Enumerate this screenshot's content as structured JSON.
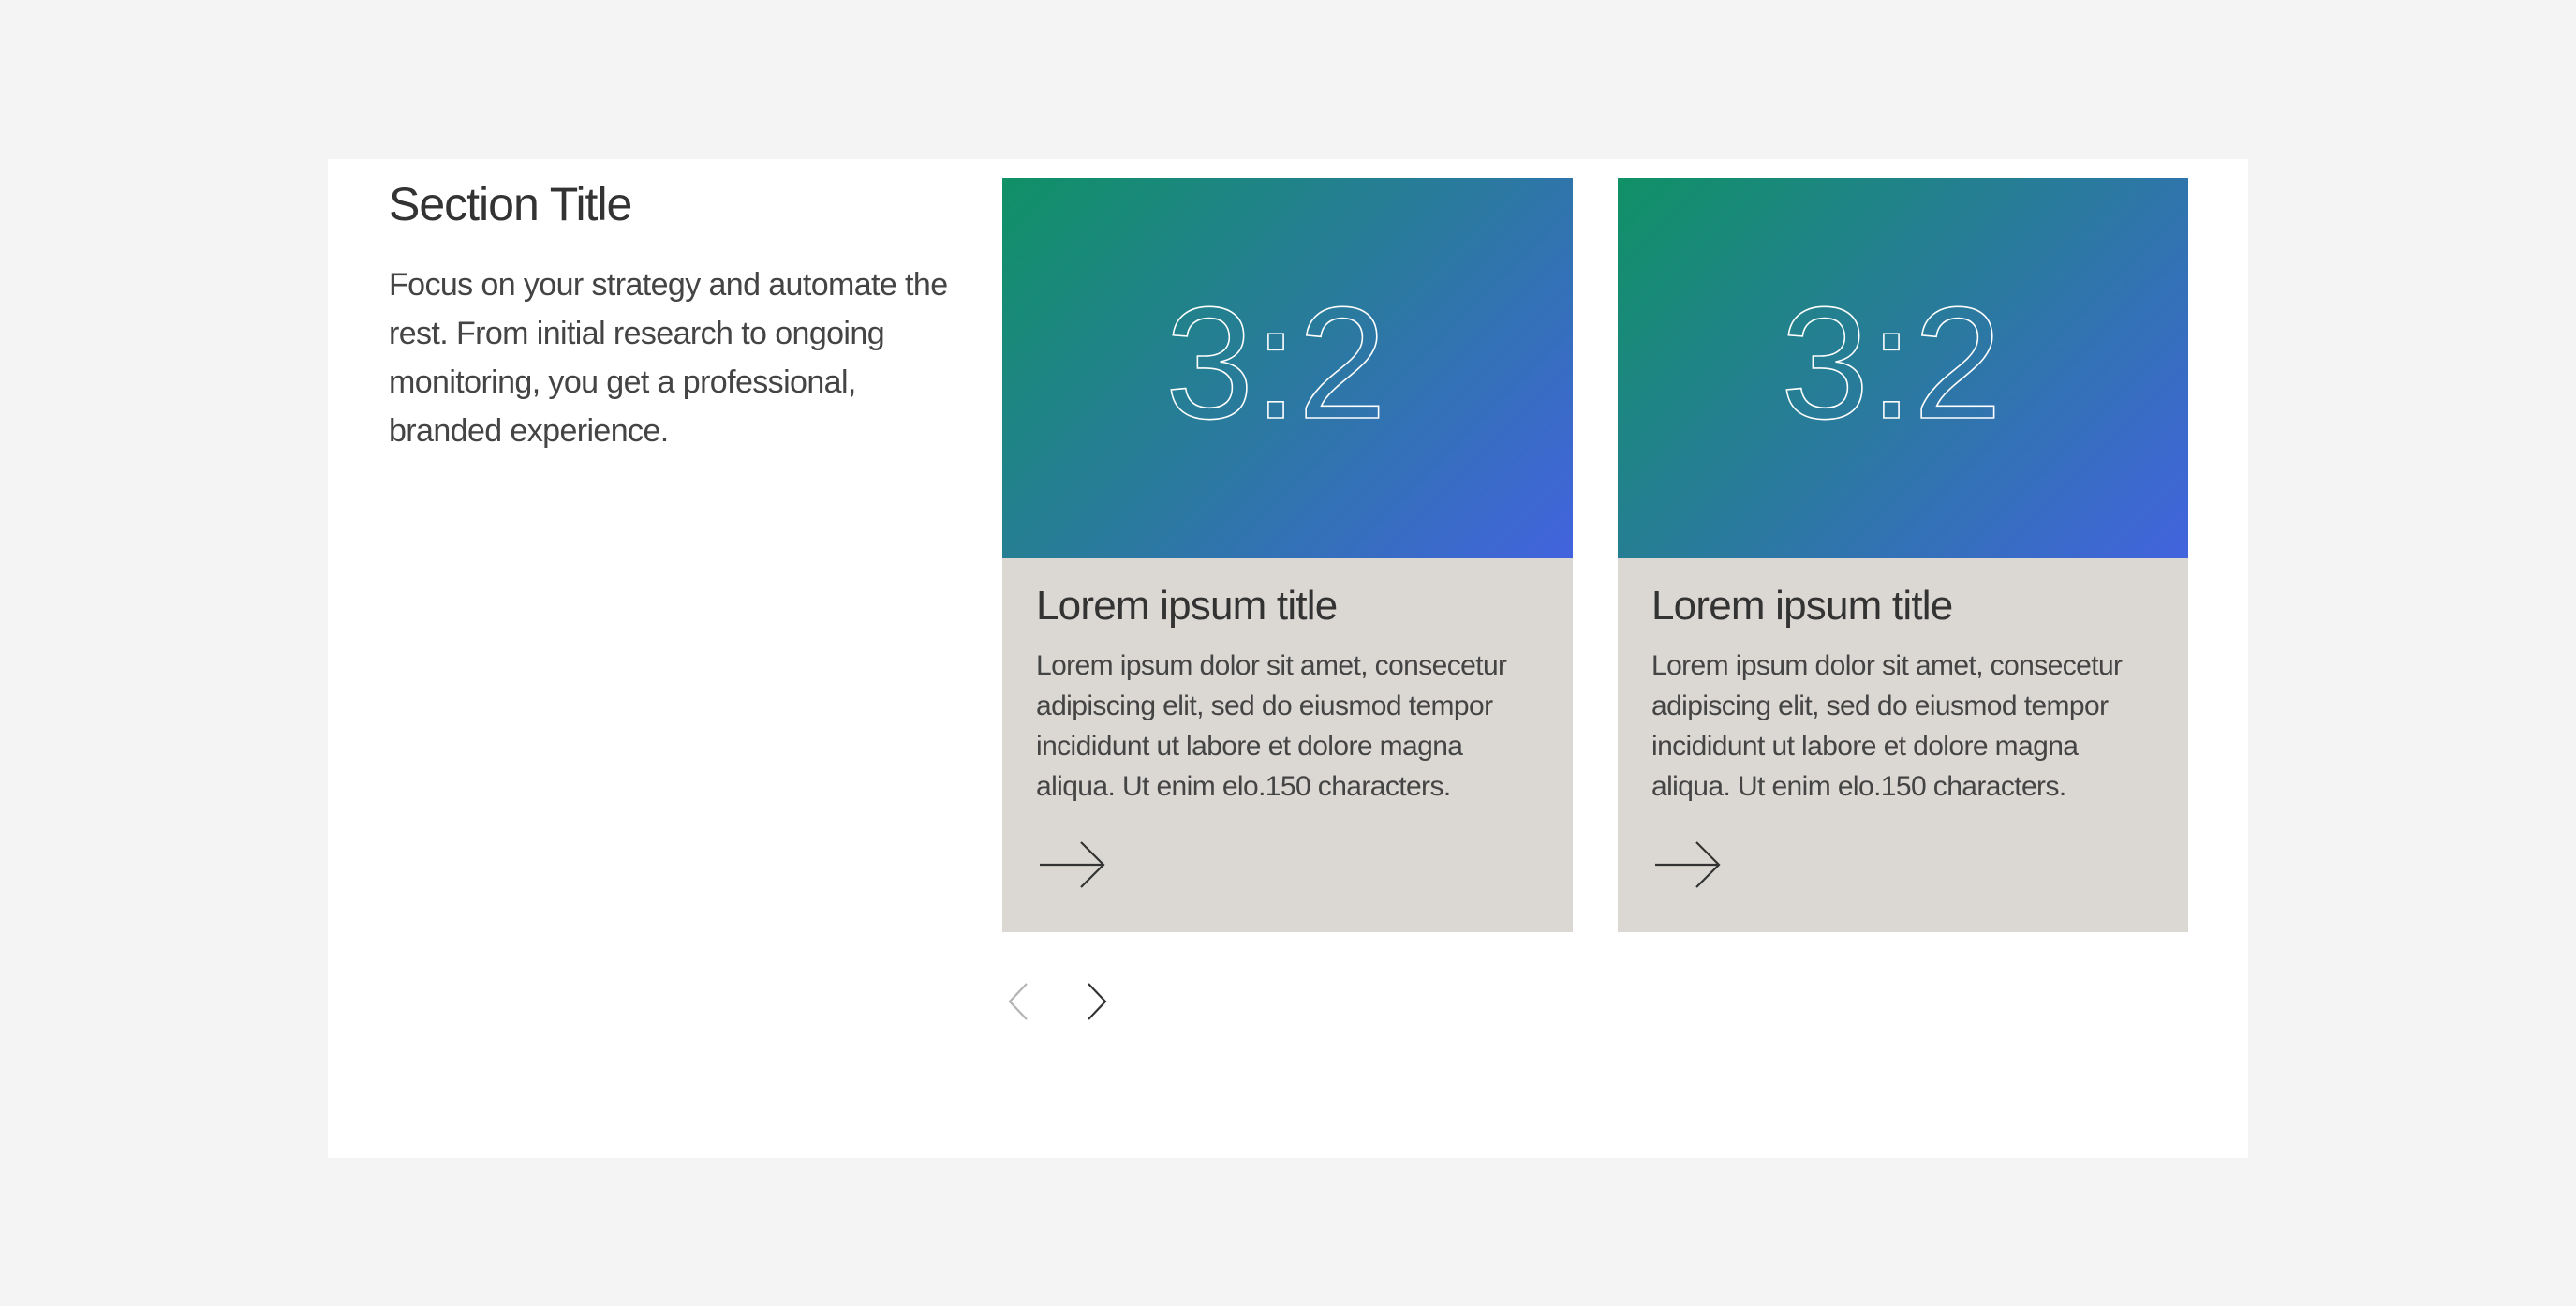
{
  "section": {
    "title": "Section Title",
    "description": "Focus on your strategy and automate the rest. From initial research to ongoing monitoring, you get a professional, branded experience."
  },
  "cards": [
    {
      "image_label": "3:2",
      "title": "Lorem ipsum title",
      "text": "Lorem ipsum dolor sit amet, consecetur adipiscing elit, sed do eiusmod tempor incididunt ut labore et dolore magna aliqua. Ut enim elo.150 characters.",
      "arrow_icon": "arrow-right-icon"
    },
    {
      "image_label": "3:2",
      "title": "Lorem ipsum title",
      "text": "Lorem ipsum dolor sit amet, consecetur adipiscing elit, sed do eiusmod tempor incididunt ut labore et dolore magna aliqua. Ut enim elo.150 characters.",
      "arrow_icon": "arrow-right-icon"
    }
  ],
  "carousel": {
    "prev_icon": "chevron-left-icon",
    "next_icon": "chevron-right-icon",
    "prev_enabled": false,
    "next_enabled": true
  },
  "colors": {
    "page_background": "#f4f4f4",
    "panel_background": "#ffffff",
    "card_background": "#dbd8d3",
    "gradient_start": "#109166",
    "gradient_end": "#4263de",
    "text": "#333333",
    "disabled_icon": "#b3b3b3"
  }
}
